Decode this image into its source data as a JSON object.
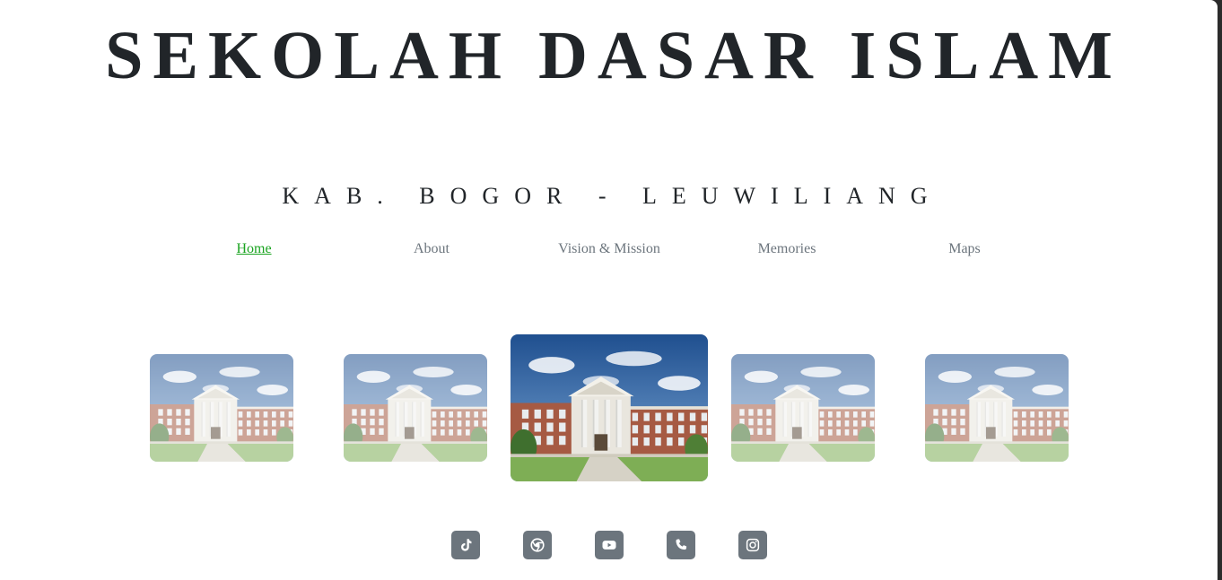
{
  "header": {
    "title": "SEKOLAH DASAR ISLAM",
    "subtitle": "KAB. BOGOR - LEUWILIANG"
  },
  "nav": {
    "items": [
      {
        "label": "Home",
        "active": true
      },
      {
        "label": "About",
        "active": false
      },
      {
        "label": "Vision & Mission",
        "active": false
      },
      {
        "label": "Memories",
        "active": false
      },
      {
        "label": "Maps",
        "active": false
      }
    ]
  },
  "carousel": {
    "image": "school-building-photo",
    "count": 5,
    "active_index": 2
  },
  "social": [
    {
      "icon": "tiktok-icon"
    },
    {
      "icon": "chrome-icon"
    },
    {
      "icon": "youtube-icon"
    },
    {
      "icon": "phone-icon"
    },
    {
      "icon": "instagram-icon"
    }
  ],
  "colors": {
    "text": "#212529",
    "nav_muted": "#6c757d",
    "nav_active": "#19a31f",
    "icon_bg": "#6c757d"
  }
}
